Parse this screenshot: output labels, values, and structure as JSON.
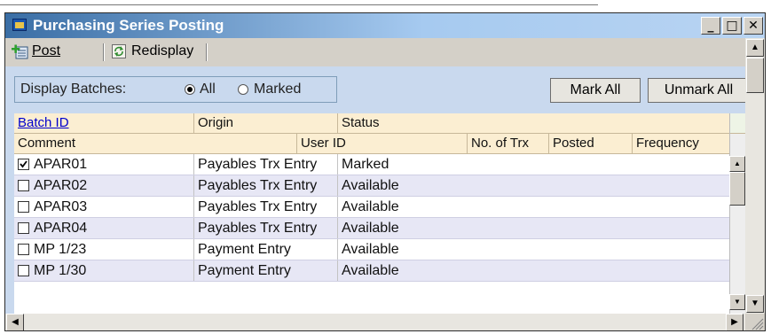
{
  "window": {
    "title": "Purchasing Series Posting",
    "minimize_glyph": "_",
    "maximize_glyph": "□",
    "close_glyph": "✕"
  },
  "toolbar": {
    "post_label": "Post",
    "redisplay_label": "Redisplay"
  },
  "display_batches": {
    "label": "Display Batches:",
    "options": [
      {
        "label": "All",
        "selected": true
      },
      {
        "label": "Marked",
        "selected": false
      }
    ]
  },
  "buttons": {
    "mark_all": "Mark All",
    "unmark_all": "Unmark All"
  },
  "grid": {
    "header_row1": [
      "Batch ID",
      "Origin",
      "Status"
    ],
    "header_row2": [
      "Comment",
      "User ID",
      "No. of Trx",
      "Posted",
      "Frequency"
    ],
    "rows": [
      {
        "checked": true,
        "batch_id": "APAR01",
        "origin": "Payables Trx Entry",
        "status": "Marked"
      },
      {
        "checked": false,
        "batch_id": "APAR02",
        "origin": "Payables Trx Entry",
        "status": "Available"
      },
      {
        "checked": false,
        "batch_id": "APAR03",
        "origin": "Payables Trx Entry",
        "status": "Available"
      },
      {
        "checked": false,
        "batch_id": "APAR04",
        "origin": "Payables Trx Entry",
        "status": "Available"
      },
      {
        "checked": false,
        "batch_id": "MP 1/23",
        "origin": "Payment Entry",
        "status": "Available"
      },
      {
        "checked": false,
        "batch_id": "MP 1/30",
        "origin": "Payment Entry",
        "status": "Available"
      }
    ]
  },
  "colors": {
    "title_gradient_start": "#3a6ea5",
    "content_background": "#c9d9ee",
    "header_background": "#fbeed2",
    "alt_row_background": "#e7e7f5",
    "link_color": "#0000cc"
  },
  "icons": {
    "app": "window-app-icon",
    "post": "post-icon",
    "redisplay": "redisplay-icon"
  }
}
